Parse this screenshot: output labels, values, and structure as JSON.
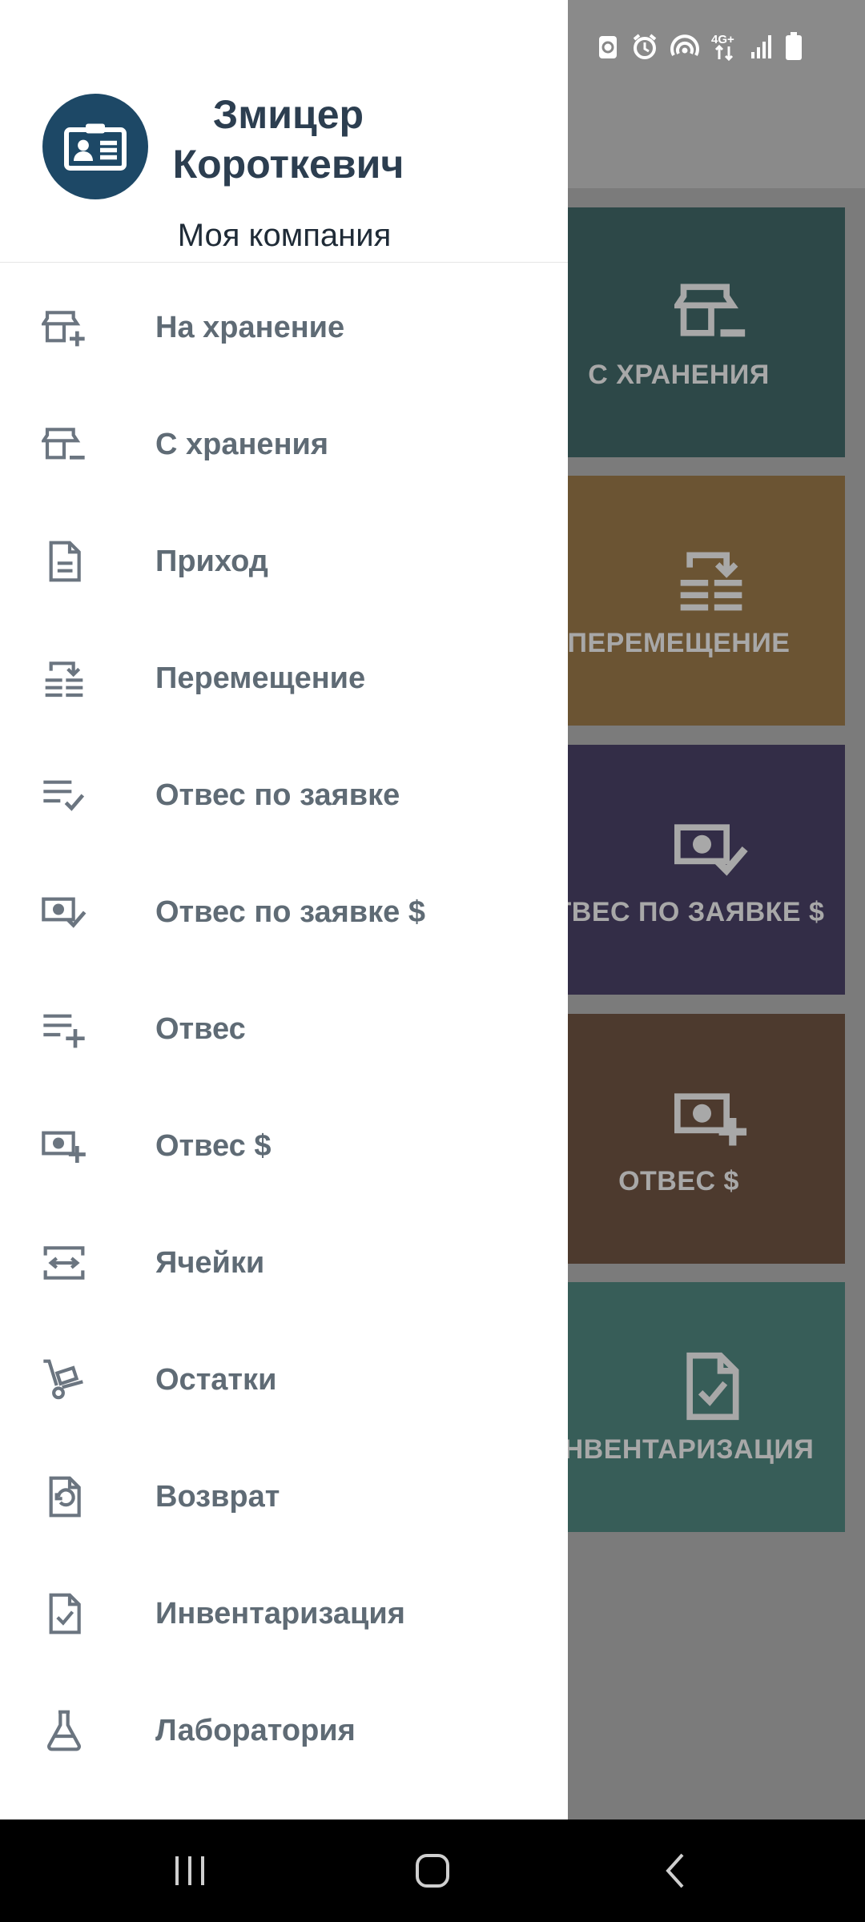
{
  "drawer": {
    "user_name": "Змицер Короткевич",
    "company": "Моя компания",
    "items": [
      {
        "label": "На хранение",
        "icon": "store-plus-icon"
      },
      {
        "label": "С хранения",
        "icon": "store-minus-icon"
      },
      {
        "label": "Приход",
        "icon": "document-icon"
      },
      {
        "label": "Перемещение",
        "icon": "transfer-icon"
      },
      {
        "label": "Отвес по заявке",
        "icon": "list-check-icon"
      },
      {
        "label": "Отвес по заявке $",
        "icon": "money-check-icon"
      },
      {
        "label": "Отвес",
        "icon": "list-plus-icon"
      },
      {
        "label": "Отвес $",
        "icon": "money-plus-icon"
      },
      {
        "label": "Ячейки",
        "icon": "cells-icon"
      },
      {
        "label": "Остатки",
        "icon": "cart-icon"
      },
      {
        "label": "Возврат",
        "icon": "return-document-icon"
      },
      {
        "label": "Инвентаризация",
        "icon": "document-check-icon"
      },
      {
        "label": "Лаборатория",
        "icon": "flask-icon"
      }
    ]
  },
  "background_tiles": [
    {
      "label": "С ХРАНЕНИЯ",
      "color": "#2d4848",
      "icon": "store-minus-icon"
    },
    {
      "label": "ПЕРЕМЕЩЕНИЕ",
      "color": "#6b5433",
      "icon": "transfer-icon"
    },
    {
      "label": "ОТВЕС ПО ЗАЯВКЕ $",
      "color": "#332d47",
      "icon": "money-check-icon"
    },
    {
      "label": "ОТВЕС $",
      "color": "#4d3a2e",
      "icon": "money-plus-icon"
    },
    {
      "label": "ИНВЕНТАРИЗАЦИЯ",
      "color": "#375d58",
      "icon": "document-check-icon"
    }
  ],
  "status_bar": {
    "network": "4G+"
  },
  "colors": {
    "avatar": "#1d4866",
    "menu_text": "#5f6b75",
    "header_text": "#2c3e50"
  }
}
